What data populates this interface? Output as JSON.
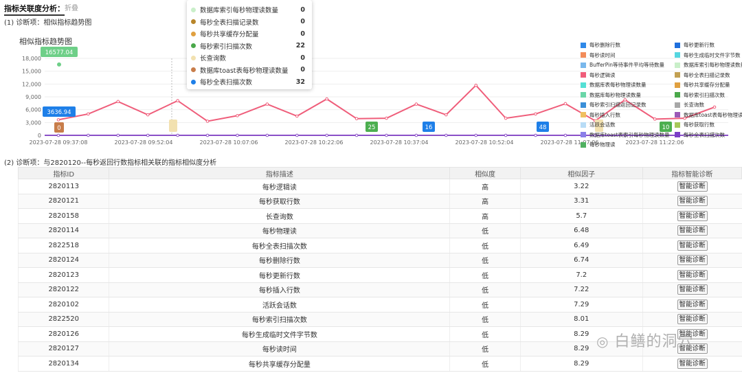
{
  "header": {
    "title": "指标关联度分析：",
    "collapse": "折叠"
  },
  "section1": {
    "label": "(1)   诊断项：相似指标趋势图"
  },
  "chart_title": "相似指标趋势图",
  "chart_data": {
    "type": "line",
    "yticks": [
      "18,000",
      "15,000",
      "12,000",
      "9,000",
      "6,000",
      "3,000",
      "0"
    ],
    "ylim": [
      0,
      18000
    ],
    "xticks": [
      "2023-07-28 09:37:08",
      "2023-07-28 09:52:04",
      "2023-07-28 10:07:06",
      "2023-07-28 10:22:06",
      "2023-07-28 10:37:04",
      "2023-07-28 10:52:04",
      "2023-07-28 11:07:06",
      "2023-07-28 11:22:06"
    ],
    "series": [
      {
        "values": [
          3637,
          5000,
          7900,
          4800,
          8100,
          3300,
          4600,
          7300,
          4500,
          8500,
          3900,
          4000,
          7300,
          4800,
          11700,
          4000,
          5000,
          7400,
          3400,
          8300,
          3800,
          4000,
          6600
        ]
      }
    ],
    "markers": [
      {
        "label": "16577.04",
        "value": 16577,
        "color": "#6ecf88"
      },
      {
        "label": "3636.94",
        "value": 3637,
        "color": "#1e7fe8"
      },
      {
        "label": "0",
        "value": 0,
        "color": "#c87d4a"
      },
      {
        "label": "25",
        "value": 0,
        "color": "#4caf50"
      },
      {
        "label": "16",
        "value": 0,
        "color": "#1e7fe8"
      },
      {
        "label": "48",
        "value": 0,
        "color": "#1e7fe8"
      },
      {
        "label": "10",
        "value": 0,
        "color": "#4caf50"
      }
    ]
  },
  "legend": [
    {
      "label": "每秒删除行数",
      "color": "#2f89e8"
    },
    {
      "label": "每秒更新行数",
      "color": "#1f6fdc"
    },
    {
      "label": "每秒读时间",
      "color": "#f28c5a"
    },
    {
      "label": "每秒生成临时文件字节数",
      "color": "#55d6e0"
    },
    {
      "label": "BufferPin等待事件平均等待数量",
      "color": "#7ab8ec"
    },
    {
      "label": "数据库索引每秒物理读数量",
      "color": "#c9efc9"
    },
    {
      "label": "每秒逻辑读",
      "color": "#ef5d7a"
    },
    {
      "label": "每秒全表扫描记录数",
      "color": "#c2a052"
    },
    {
      "label": "数据库表每秒物理读数量",
      "color": "#55e0d5"
    },
    {
      "label": "每秒共享缓存分配量",
      "color": "#e0a040"
    },
    {
      "label": "数据库每秒物理读数量",
      "color": "#6ad6a8"
    },
    {
      "label": "每秒索引扫描次数",
      "color": "#4aa84a"
    },
    {
      "label": "每秒索引扫描返回记录数",
      "color": "#3a8fd8"
    },
    {
      "label": "长查询数",
      "color": "#a7a7a7"
    },
    {
      "label": "每秒插入行数",
      "color": "#f0c060"
    },
    {
      "label": "数据库toast表每秒物理读",
      "color": "#9b59b6"
    },
    {
      "label": "活跃会话数",
      "color": "#b8dcf6"
    },
    {
      "label": "每秒获取行数",
      "color": "#a6c85a"
    },
    {
      "label": "数据库toast表索引每秒物理读数量",
      "color": "#8a7ee8"
    },
    {
      "label": "每秒全表扫描次数",
      "color": "#7a3fc8"
    },
    {
      "label": "每秒物理读",
      "color": "#50b060"
    }
  ],
  "tooltip": [
    {
      "label": "数据库索引每秒物理读数量",
      "value": "0",
      "color": "#c9efc9"
    },
    {
      "label": "每秒全表扫描记录数",
      "value": "0",
      "color": "#b8862a"
    },
    {
      "label": "每秒共享缓存分配量",
      "value": "0",
      "color": "#e0a040"
    },
    {
      "label": "每秒索引扫描次数",
      "value": "22",
      "color": "#4aa84a"
    },
    {
      "label": "长查询数",
      "value": "0",
      "color": "#f2e1b0"
    },
    {
      "label": "数据库toast表每秒物理读数量",
      "value": "0",
      "color": "#c87d4a"
    },
    {
      "label": "每秒全表扫描次数",
      "value": "32",
      "color": "#1e7fe8"
    }
  ],
  "section2": {
    "label": "(2)   诊断项：与2820120--每秒返回行数指标相关联的指标相似度分析"
  },
  "table": {
    "headers": [
      "指标ID",
      "指标描述",
      "相似度",
      "相似因子",
      "指标智能诊断"
    ],
    "button_label": "智能诊断",
    "rows": [
      [
        "2820113",
        "每秒逻辑读",
        "高",
        "3.22"
      ],
      [
        "2820121",
        "每秒获取行数",
        "高",
        "3.31"
      ],
      [
        "2820158",
        "长查询数",
        "高",
        "5.7"
      ],
      [
        "2820114",
        "每秒物理读",
        "低",
        "6.48"
      ],
      [
        "2822518",
        "每秒全表扫描次数",
        "低",
        "6.49"
      ],
      [
        "2820124",
        "每秒删除行数",
        "低",
        "6.74"
      ],
      [
        "2820123",
        "每秒更新行数",
        "低",
        "7.2"
      ],
      [
        "2820122",
        "每秒插入行数",
        "低",
        "7.22"
      ],
      [
        "2820102",
        "活跃会话数",
        "低",
        "7.29"
      ],
      [
        "2822520",
        "每秒索引扫描次数",
        "低",
        "8.01"
      ],
      [
        "2820126",
        "每秒生成临时文件字节数",
        "低",
        "8.29"
      ],
      [
        "2820127",
        "每秒读时间",
        "低",
        "8.29"
      ],
      [
        "2820134",
        "每秒共享缓存分配量",
        "低",
        "8.29"
      ]
    ]
  },
  "watermark": "白鳝的洞穴"
}
